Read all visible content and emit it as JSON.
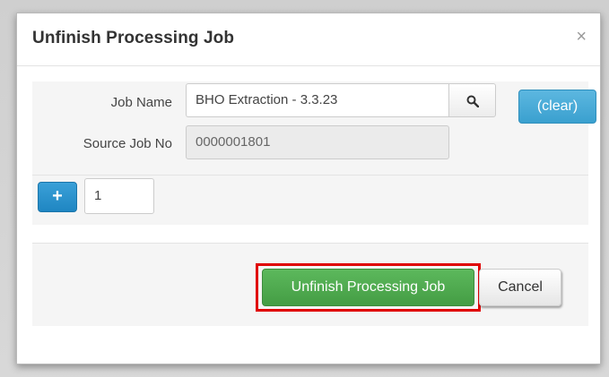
{
  "dialog": {
    "title": "Unfinish Processing Job",
    "close_symbol": "×"
  },
  "form": {
    "job_name_label": "Job Name",
    "job_name_value": "BHO Extraction - 3.3.23",
    "search_icon": "search-icon",
    "clear_label": "(clear)",
    "source_job_label": "Source Job No",
    "source_job_value": "0000001801",
    "add_icon": "plus-icon",
    "add_symbol": "+",
    "quantity_value": "1"
  },
  "footer": {
    "primary_label": "Unfinish Processing Job",
    "cancel_label": "Cancel"
  },
  "colors": {
    "primary": "#5cb85c",
    "info": "#3aa0cf",
    "highlight": "#e00000"
  }
}
